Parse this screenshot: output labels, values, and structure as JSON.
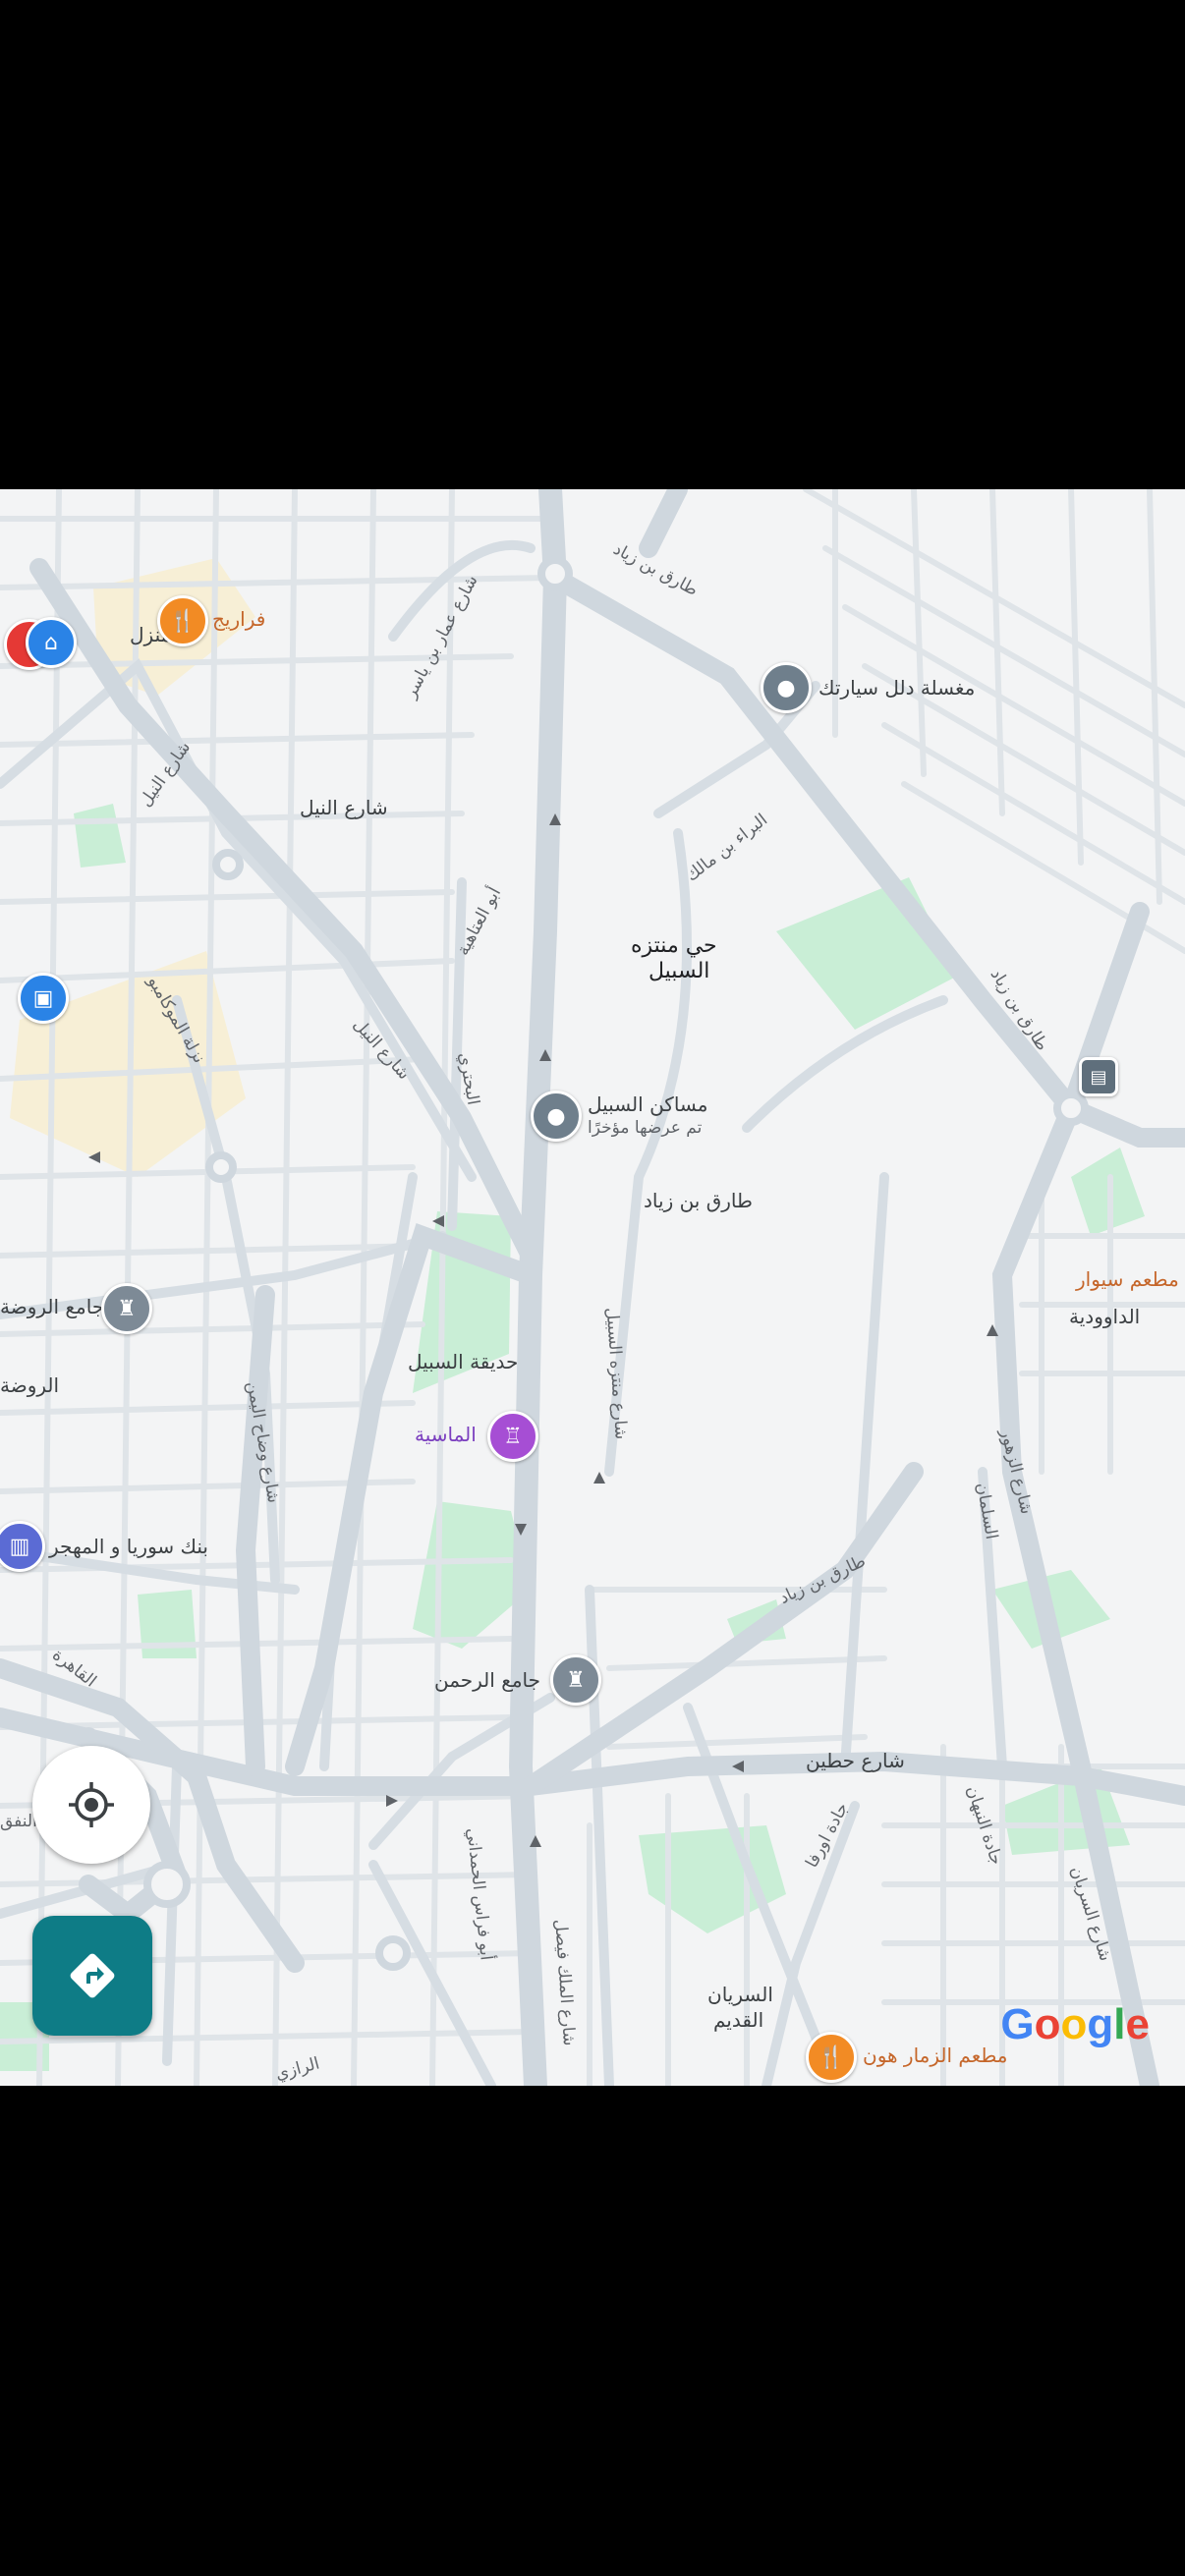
{
  "map": {
    "labels": {
      "home": "المنزل",
      "restaurant_1": "فراريج",
      "car_wash": "مغسلة دلل سيارتك",
      "tariq_bin_ziyad_top": "طارق بن زياد",
      "ammar_bin_yasser": "شارع عمار بن ياسر",
      "al_nil_1": "شارع النيل",
      "al_nil_2": "شارع النيل",
      "al_nil_3": "شارع النيل",
      "al_baraa": "البراء بن مالك",
      "hay_muntazah": "حي منتزه",
      "al_sabil": "السبيل",
      "abu_al_ataheya": "أبو العتاهية",
      "nazlet_mawkamo": "نزلة الموكامبو",
      "tariq_bin_ziyad_right": "طارق بن زياد",
      "masaken_sabil": "مساكن السبيل",
      "recently_viewed": "تم عرضها مؤخرًا",
      "al_buhturi": "البحتري",
      "tariq_bin_ziyad_mid": "طارق بن زياد",
      "jami_al_rawda": "جامع الروضة",
      "al_rawda": "الروضة",
      "restaurant_siwar": "مطعم سيوار",
      "al_dawoudiya": "الداوودية",
      "hadiqat_sabil": "حديقة السبيل",
      "al_masiya": "الماسية",
      "muntazah_sabil_st": "شارع منتزه السبيل",
      "waddah_yemen": "شارع وضاح اليمن",
      "al_zahour": "شارع الزهور",
      "al_sulaiman": "السلمان",
      "bank_syria": "بنك سوريا و المهجر",
      "tariq_bin_ziyad_low": "طارق بن زياد",
      "al_qahira": "القاهرة",
      "jami_rahman": "جامع الرحمن",
      "hitteen": "شارع حطين",
      "jadat_orfa": "جادة اورفا",
      "jadat_nabhan": "جادة النبهان",
      "abu_firas": "أبو فراس الحمداني",
      "malik_faisal": "شارع الملك فيصل",
      "al_siryan_st": "شارع السريان",
      "al_siryan": "السريان",
      "al_qadim": "القديم",
      "restaurant_zammar": "مطعم الزمار هون",
      "al_razi": "الرازي",
      "al_nafaq": "النفق"
    },
    "icons": {
      "home_pin": "home-icon",
      "restaurant_pin": "fork-knife-icon",
      "generic_pin": "place-icon",
      "shopping_pin": "shopping-bag-icon",
      "transit_pin": "bus-icon",
      "mosque_pin": "mosque-icon",
      "attraction_pin": "landmark-icon",
      "bank_pin": "bank-icon"
    },
    "colors": {
      "land": "#f3f4f5",
      "road": "#d6dde3",
      "park": "#c9eed6",
      "restaurant": "#f28b24",
      "place": "#6f7f8c",
      "mosque": "#7d8a96",
      "purple": "#a64ed4",
      "blue": "#2a83e6",
      "teal": "#0e7c86"
    }
  },
  "controls": {
    "my_location": "my-location-icon",
    "directions": "directions-icon"
  },
  "attribution": {
    "G": "G",
    "o1": "o",
    "o2": "o",
    "g": "g",
    "l": "l",
    "e": "e"
  }
}
